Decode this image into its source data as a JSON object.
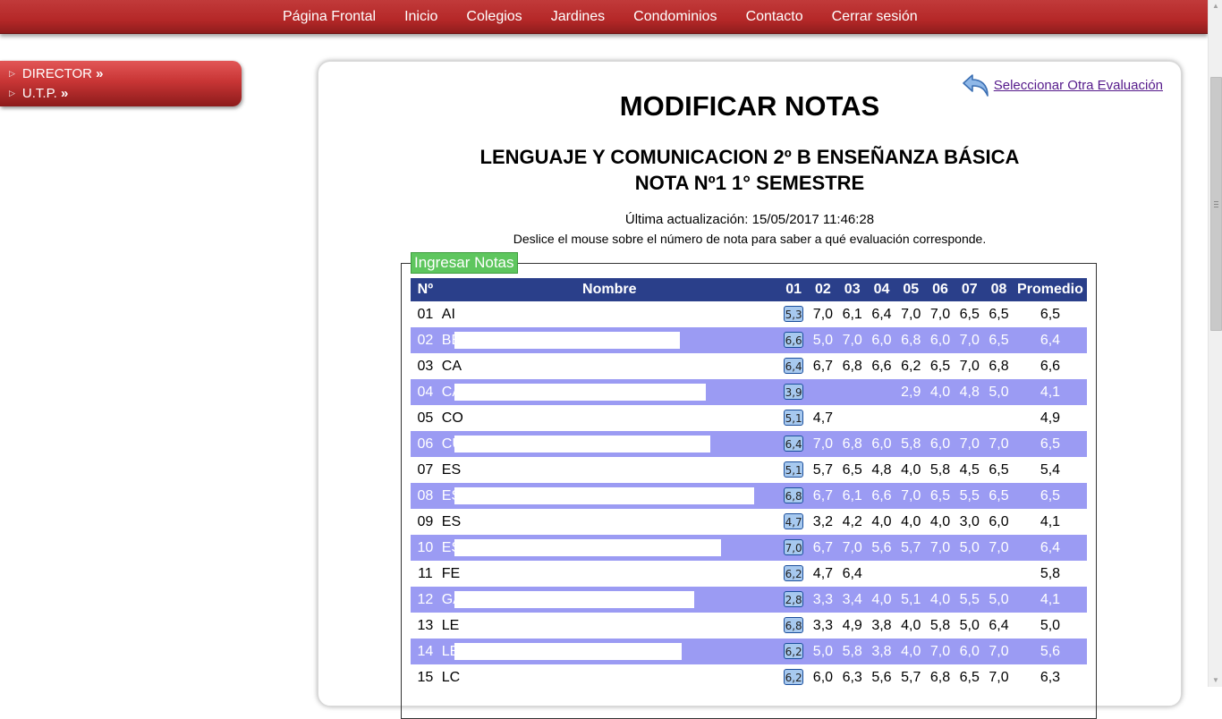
{
  "nav": [
    "Página Frontal",
    "Inicio",
    "Colegios",
    "Jardines",
    "Condominios",
    "Contacto",
    "Cerrar sesión"
  ],
  "side_menu": [
    {
      "label": "DIRECTOR",
      "suffix": "»"
    },
    {
      "label": "U.T.P.",
      "suffix": "»"
    }
  ],
  "back_link": "Seleccionar Otra Evaluación",
  "title": "MODIFICAR NOTAS",
  "subtitle_line1": "LENGUAJE Y COMUNICACION 2º B ENSEÑANZA BÁSICA",
  "subtitle_line2": "NOTA Nº1 1° SEMESTRE",
  "last_update": "Última actualización: 15/05/2017 11:46:28",
  "hint": "Deslice el mouse sobre el número de nota para saber a qué evaluación corresponde.",
  "legend": "Ingresar Notas",
  "table": {
    "headers": [
      "Nº",
      "Nombre",
      "01",
      "02",
      "03",
      "04",
      "05",
      "06",
      "07",
      "08",
      "Promedio"
    ],
    "rows": [
      {
        "n": "01",
        "name": "AI",
        "g": [
          "5,3",
          "7,0",
          "6,1",
          "6,4",
          "7,0",
          "7,0",
          "6,5",
          "6,5"
        ],
        "avg": "6,5"
      },
      {
        "n": "02",
        "name": "BE",
        "g": [
          "6,6",
          "5,0",
          "7,0",
          "6,0",
          "6,8",
          "6,0",
          "7,0",
          "6,5"
        ],
        "avg": "6,4"
      },
      {
        "n": "03",
        "name": "CA",
        "g": [
          "6,4",
          "6,7",
          "6,8",
          "6,6",
          "6,2",
          "6,5",
          "7,0",
          "6,8"
        ],
        "avg": "6,6"
      },
      {
        "n": "04",
        "name": "CA",
        "g": [
          "3,9",
          "",
          "",
          "",
          "2,9",
          "4,0",
          "4,8",
          "5,0"
        ],
        "avg": "4,1"
      },
      {
        "n": "05",
        "name": "CO",
        "g": [
          "5,1",
          "4,7",
          "",
          "",
          "",
          "",
          "",
          ""
        ],
        "avg": "4,9"
      },
      {
        "n": "06",
        "name": "CU",
        "g": [
          "6,4",
          "7,0",
          "6,8",
          "6,0",
          "5,8",
          "6,0",
          "7,0",
          "7,0"
        ],
        "avg": "6,5"
      },
      {
        "n": "07",
        "name": "ES",
        "g": [
          "5,1",
          "5,7",
          "6,5",
          "4,8",
          "4,0",
          "5,8",
          "4,5",
          "6,5"
        ],
        "avg": "5,4"
      },
      {
        "n": "08",
        "name": "ES",
        "g": [
          "6,8",
          "6,7",
          "6,1",
          "6,6",
          "7,0",
          "6,5",
          "5,5",
          "6,5"
        ],
        "avg": "6,5"
      },
      {
        "n": "09",
        "name": "ES",
        "g": [
          "4,7",
          "3,2",
          "4,2",
          "4,0",
          "4,0",
          "4,0",
          "3,0",
          "6,0"
        ],
        "avg": "4,1"
      },
      {
        "n": "10",
        "name": "ES",
        "g": [
          "7,0",
          "6,7",
          "7,0",
          "5,6",
          "5,7",
          "7,0",
          "5,0",
          "7,0"
        ],
        "avg": "6,4"
      },
      {
        "n": "11",
        "name": "FE",
        "g": [
          "6,2",
          "4,7",
          "6,4",
          "",
          "",
          "",
          "",
          ""
        ],
        "avg": "5,8"
      },
      {
        "n": "12",
        "name": "GA",
        "g": [
          "2,8",
          "3,3",
          "3,4",
          "4,0",
          "5,1",
          "4,0",
          "5,5",
          "5,0"
        ],
        "avg": "4,1"
      },
      {
        "n": "13",
        "name": "LE",
        "g": [
          "6,8",
          "3,3",
          "4,9",
          "3,8",
          "4,0",
          "5,8",
          "5,0",
          "6,4"
        ],
        "avg": "5,0"
      },
      {
        "n": "14",
        "name": "LE",
        "g": [
          "6,2",
          "5,0",
          "5,8",
          "3,8",
          "4,0",
          "7,0",
          "6,0",
          "7,0"
        ],
        "avg": "5,6"
      },
      {
        "n": "15",
        "name": "LC",
        "g": [
          "6,2",
          "6,0",
          "6,3",
          "5,6",
          "5,7",
          "6,8",
          "6,5",
          "7,0"
        ],
        "avg": "6,3"
      }
    ]
  }
}
